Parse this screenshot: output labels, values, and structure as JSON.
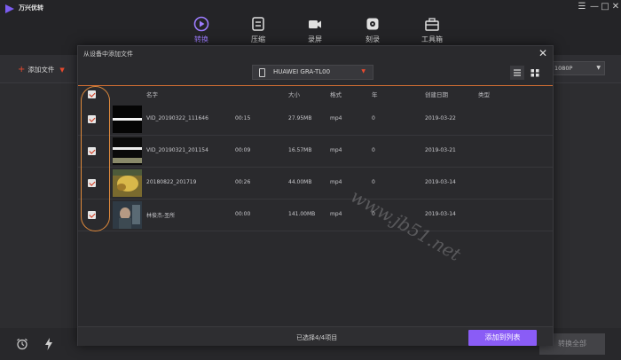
{
  "app": {
    "title": "万兴优转",
    "window_controls": [
      "☰",
      "—",
      "□",
      "✕"
    ]
  },
  "nav": [
    {
      "label": "转换",
      "icon": "play-circle-icon",
      "active": true
    },
    {
      "label": "压缩",
      "icon": "compress-icon",
      "active": false
    },
    {
      "label": "录屏",
      "icon": "camera-icon",
      "active": false
    },
    {
      "label": "刻录",
      "icon": "disc-icon",
      "active": false
    },
    {
      "label": "工具箱",
      "icon": "toolbox-icon",
      "active": false
    }
  ],
  "toolbar": {
    "add_file_label": "添加文件",
    "resolution_value": "1080P"
  },
  "bottom": {
    "convert_all_label": "转换全部"
  },
  "dialog": {
    "title": "从设备中添加文件",
    "device_name": "HUAWEI GRA-TL00",
    "columns": {
      "name": "名字",
      "size": "大小",
      "format": "格式",
      "year": "年",
      "created": "创建日期",
      "type": "类型"
    },
    "files": [
      {
        "name": "VID_20190322_111646",
        "duration": "00:15",
        "size": "27.95MB",
        "format": "mp4",
        "year": "0",
        "created": "2019-03-22",
        "checked": true
      },
      {
        "name": "VID_20190321_201154",
        "duration": "00:09",
        "size": "16.57MB",
        "format": "mp4",
        "year": "0",
        "created": "2019-03-21",
        "checked": true
      },
      {
        "name": "20180822_201719",
        "duration": "00:26",
        "size": "44.00MB",
        "format": "mp4",
        "year": "0",
        "created": "2019-03-14",
        "checked": true
      },
      {
        "name": "林俊杰-圣所",
        "duration": "00:00",
        "size": "141.00MB",
        "format": "mp4",
        "year": "0",
        "created": "2019-03-14",
        "checked": true
      }
    ],
    "selected_count": "已选择4/4项目",
    "add_to_list_label": "添加到列表"
  },
  "watermark": "www.jb51.net",
  "colors": {
    "accent": "#8a5cf6",
    "highlight_orange": "#e08a3c",
    "check_red": "#d23a1e"
  }
}
